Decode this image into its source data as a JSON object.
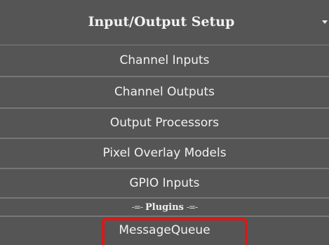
{
  "menu": {
    "title": "Input/Output Setup",
    "caret_icon": "caret-down-icon",
    "items": [
      {
        "label": "Channel Inputs"
      },
      {
        "label": "Channel Outputs"
      },
      {
        "label": "Output Processors"
      },
      {
        "label": "Pixel Overlay Models"
      },
      {
        "label": "GPIO Inputs"
      }
    ],
    "section": {
      "label": "Plugins",
      "left_decoration": "-=-",
      "right_decoration": "-=-"
    },
    "plugins": [
      {
        "label": "MessageQueue",
        "highlighted": true
      }
    ]
  },
  "colors": {
    "menu_background": "#555555",
    "separator": "#777777",
    "text": "#f2f2f2",
    "highlight": "#d61a1a"
  }
}
